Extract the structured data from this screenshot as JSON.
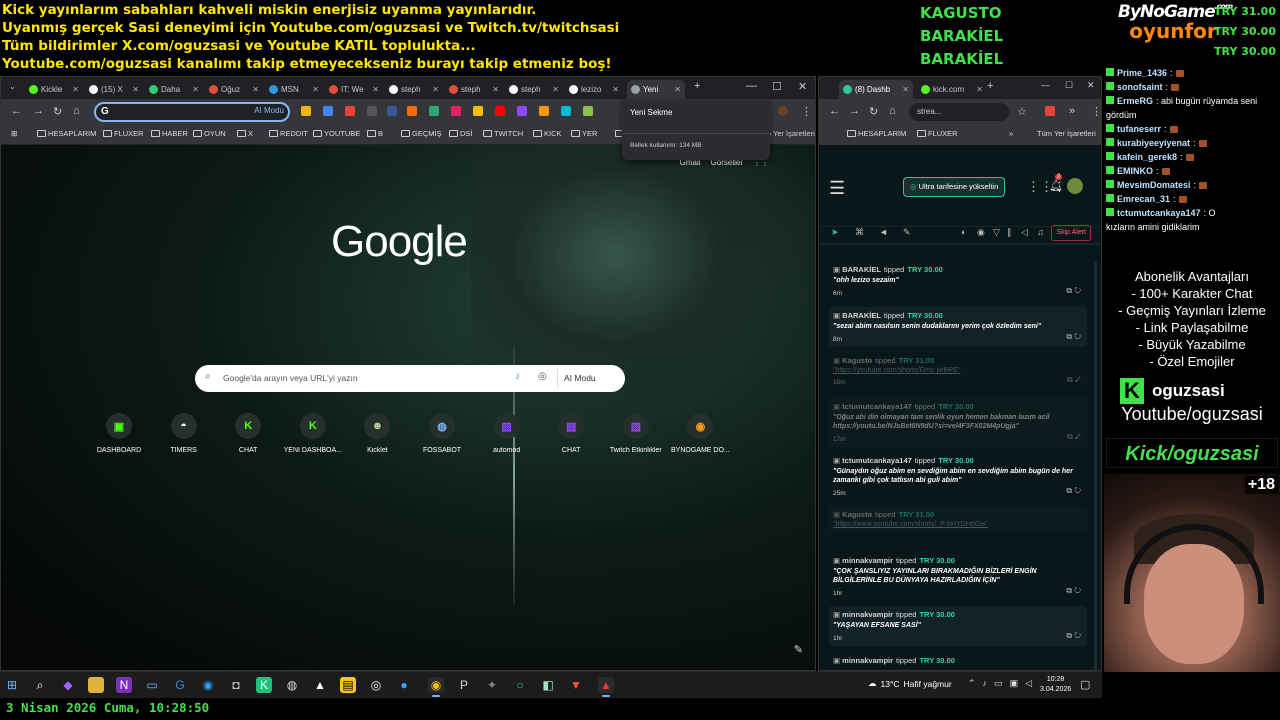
{
  "overlay": {
    "lines": [
      "Kick yayınlarım sabahları kahveli miskin enerjisiz uyanma yayınlarıdır.",
      "Uyanmış gerçek Sasi deneyimi için Youtube.com/oguzsasi ve Twitch.tv/twitchsasi",
      "Tüm bildirimler X.com/oguzsasi ve Youtube KATIL toplulukta...",
      "Youtube.com/oguzsasi kanalımı takip etmeyecekseniz burayı takip etmeniz boş!"
    ],
    "donors": [
      "KAGUSTO",
      "BARAKİEL",
      "BARAKİEL"
    ],
    "amounts": [
      "TRY 31.00",
      "TRY 30.00",
      "TRY 30.00"
    ],
    "logo_top": "ByNoGame",
    "logo_com": ".com",
    "logo_bottom": "oyunfor"
  },
  "left_browser": {
    "tabs": [
      {
        "label": "Kickle",
        "color": "#53fc18"
      },
      {
        "label": "(15) X",
        "color": "#ffffff"
      },
      {
        "label": "Daha",
        "color": "#2ecc71"
      },
      {
        "label": "Oğuz",
        "color": "#e74c3c"
      },
      {
        "label": "MSN",
        "color": "#3498db"
      },
      {
        "label": "IT: We",
        "color": "#e74c3c"
      },
      {
        "label": "steph",
        "color": "#ffffff"
      },
      {
        "label": "steph",
        "color": "#e74c3c"
      },
      {
        "label": "steph",
        "color": "#ffffff"
      },
      {
        "label": "lezizo",
        "color": "#ffffff"
      },
      {
        "label": "Yeni",
        "color": "#9aa0a6"
      }
    ],
    "window_controls": {
      "minimize": "—",
      "maximize": "☐",
      "close": "✕"
    },
    "new_tab": "+",
    "omnibox_value": "G",
    "omnibox_ai": "AI Modu",
    "bookmarks": [
      "HESAPLARIM",
      "FLUXER",
      "HABER",
      "OYUN",
      "X",
      "REDDIT",
      "YOUTUBE",
      "B",
      "GEÇMİŞ",
      "DSİ",
      "TWITCH",
      "KICK",
      "YER",
      "ye"
    ],
    "bookmarks_other": "Tüm Yer İşaretleri",
    "hover_card": {
      "title": "Yeni Sekme",
      "memory": "Bellek kullanımı: 134 MB"
    },
    "ntp": {
      "top_links": [
        "Gmail",
        "Görseller"
      ],
      "logo": "Google",
      "search_placeholder": "Google'da arayın veya URL'yi yazın",
      "ai_mode": "AI Modu",
      "shortcuts": [
        {
          "label": "DASHBOARD",
          "glyph": "▣",
          "color": "#53fc18"
        },
        {
          "label": "TIMERS",
          "glyph": "◓",
          "color": "#ffffff"
        },
        {
          "label": "CHAT",
          "glyph": "K",
          "color": "#53fc18"
        },
        {
          "label": "YENİ DASHBOA...",
          "glyph": "K",
          "color": "#53fc18"
        },
        {
          "label": "Kicklet",
          "glyph": "☻",
          "color": "#c8c8a0"
        },
        {
          "label": "FOSSABOT",
          "glyph": "◍",
          "color": "#7fb2ff"
        },
        {
          "label": "automod",
          "glyph": "▨",
          "color": "#9146ff"
        },
        {
          "label": "CHAT",
          "glyph": "▨",
          "color": "#9146ff"
        },
        {
          "label": "Twitch Etkinlikler",
          "glyph": "▨",
          "color": "#9146ff"
        },
        {
          "label": "BYNOGAME DO...",
          "glyph": "◉",
          "color": "#ff9f1a"
        }
      ]
    }
  },
  "right_browser": {
    "tabs": [
      "(8) Dashb",
      "kick.com"
    ],
    "omnibox_value": "strea...",
    "bookmarks": [
      "HESAPLARIM",
      "FLUXER"
    ],
    "bookmarks_other": "Tüm Yer İşaretleri",
    "upgrade_label": "Ultra tarifesine yükseltin",
    "notif_count": "2",
    "skip_alert": "Skip Alert",
    "feed": [
      {
        "name": "BARAKİEL",
        "verb": "tipped",
        "amount": "TRY 30.00",
        "msg": "\"ohh lezizo sezaim\"",
        "time": "6m",
        "dim": false
      },
      {
        "name": "BARAKİEL",
        "verb": "tipped",
        "amount": "TRY 30.00",
        "msg": "\"sezai abim nasılsın senin dudaklarını yerim çok özledim seni\"",
        "time": "8m",
        "dim": false
      },
      {
        "name": "Kagusto",
        "verb": "tipped",
        "amount": "TRY 31.00",
        "msg": "\"https://youtube.com/shorts/Gmz-jieBRE\"",
        "time": "15m",
        "dim": true,
        "link": true
      },
      {
        "name": "tctumutcankaya147",
        "verb": "tipped",
        "amount": "TRY 30.00",
        "msg": "\"Oğuz abi din olmayan tam senlik oyun hemen bakman lazım acil https://youtu.be/NJsBxt8N9dU?si=vel4F3FX02M4pUgja\"",
        "time": "17m",
        "dim": true
      },
      {
        "name": "tctumutcankaya147",
        "verb": "tipped",
        "amount": "TRY 30.00",
        "msg": "\"Günaydın oğuz abim en sevdiğim abim en sevdiğim abim bugün de her zamanki gibi çok tatlısın abi guli abim\"",
        "time": "25m",
        "dim": false
      },
      {
        "name": "Kagusto",
        "verb": "tipped",
        "amount": "TRY 31.00",
        "msg": "\"https://www.youtube.com/shorts/_P-bHYDH6Gw\"",
        "time": "",
        "dim": true,
        "link": true
      },
      {
        "name": "minnakvampir",
        "verb": "tipped",
        "amount": "TRY 30.00",
        "msg": "\"ÇOK ŞANSLIYIZ YAYINLARI BIRAKMADIĞIN BİZLERİ ENGİN BİLGİLERİNLE BU DÜNYAYA HAZIRLADIĞIN İÇİN\"",
        "time": "1hr",
        "dim": false
      },
      {
        "name": "minnakvampir",
        "verb": "tipped",
        "amount": "TRY 30.00",
        "msg": "\"YAŞAYAN EFSANE SASİ\"",
        "time": "1hr",
        "dim": false
      },
      {
        "name": "minnakvampir",
        "verb": "tipped",
        "amount": "TRY 30.00",
        "msg": "",
        "time": "",
        "dim": false
      }
    ]
  },
  "chat": [
    {
      "user": "Prime_1436",
      "text": ":",
      "emote": true
    },
    {
      "user": "sonofsaint",
      "text": ":",
      "emote": true
    },
    {
      "user": "ErmeRG",
      "text": ": abi bugün rüyamda seni",
      "emote": false
    },
    {
      "user": "",
      "text": "gördüm",
      "emote": false,
      "cont": true
    },
    {
      "user": "tufaneserr",
      "text": ":",
      "emote": true
    },
    {
      "user": "kurabiyeeyiyenat",
      "text": ":",
      "emote": true
    },
    {
      "user": "kafein_gerek8",
      "text": ":",
      "emote": true
    },
    {
      "user": "EMINKO",
      "text": ":",
      "emote": true
    },
    {
      "user": "MevsimDomatesi",
      "text": ":",
      "emote": true
    },
    {
      "user": "Emrecan_31",
      "text": ":",
      "emote": true
    },
    {
      "user": "tctumutcankaya147",
      "text": ": O",
      "emote": false
    },
    {
      "user": "",
      "text": "kızların amini gidiklarim",
      "emote": false,
      "cont": true
    }
  ],
  "sub_perks": [
    "Abonelik Avantajları",
    "- 100+ Karakter Chat",
    "- Geçmiş Yayınları İzleme",
    "- Link Paylaşabilme",
    "- Büyük Yazabilme",
    "- Özel Emojiler"
  ],
  "kick_handle": "oguzsasi",
  "kick_logo": "K",
  "yt_handle": "Youtube/oguzsasi",
  "kick_banner": "Kick/oguzsasi",
  "webcam_badge": "+18",
  "taskbar": {
    "weather_temp": "13°C",
    "weather_desc": "Hafif yağmur",
    "time": "10:28",
    "date": "3.04.2026"
  },
  "bottom_date": "3 Nisan 2026 Cuma, 10:28:50"
}
